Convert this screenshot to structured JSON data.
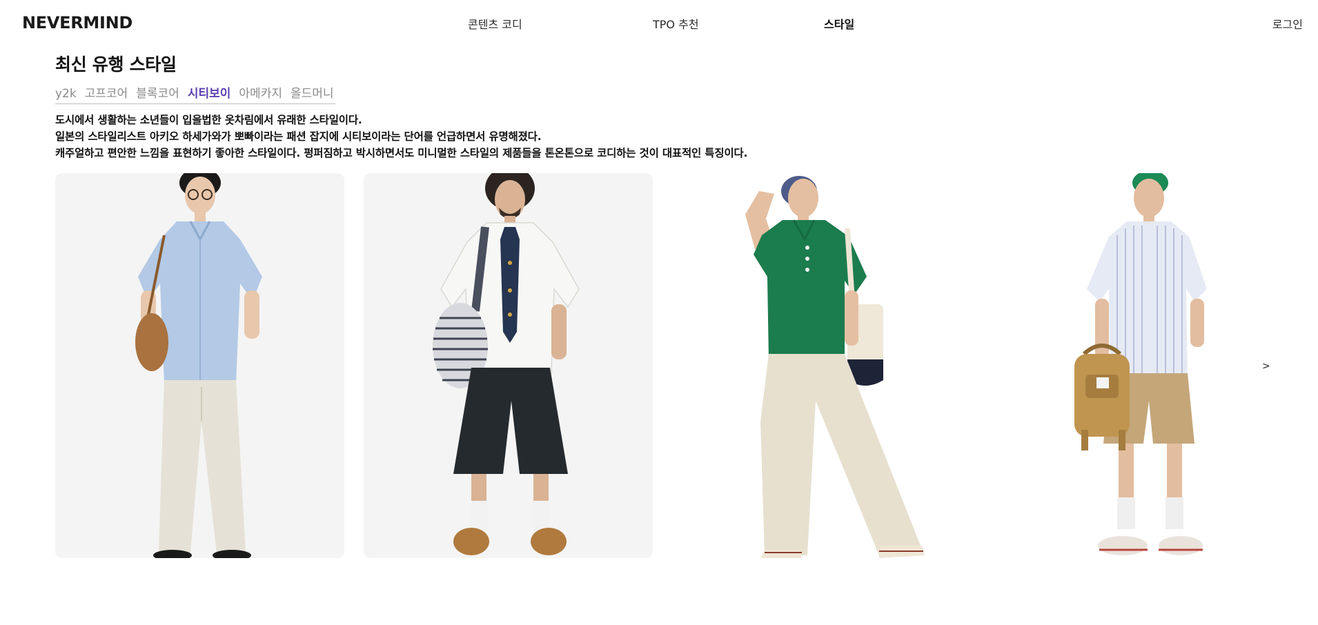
{
  "header": {
    "logo": "NEVERMIND",
    "nav": [
      "콘텐츠 코디",
      "TPO 추천",
      "스타일"
    ],
    "login": "로그인"
  },
  "main": {
    "title": "최신 유행 스타일",
    "tabs": [
      "y2k",
      "고프코어",
      "블록코어",
      "시티보이",
      "아메카지",
      "올드머니"
    ],
    "active_tab": "시티보이",
    "description": [
      "도시에서 생활하는 소년들이 입을법한 옷차림에서 유래한 스타일이다.",
      "일본의 스타일리스트 아키오 하세가와가 뽀빠이라는 패션 잡지에 시티보이라는 단어를 언급하면서 유명해졌다.",
      "캐주얼하고 편안한 느낌을 표현하기 좋아한 스타일이다. 펑퍼짐하고 박시하면서도 미니멀한 스타일의 제품들을 톤온톤으로 코디하는 것이 대표적인 특징이다."
    ],
    "next_arrow": ">"
  },
  "colors": {
    "active_tab": "#5b3fb0",
    "card_bg": "#f4f4f4"
  }
}
